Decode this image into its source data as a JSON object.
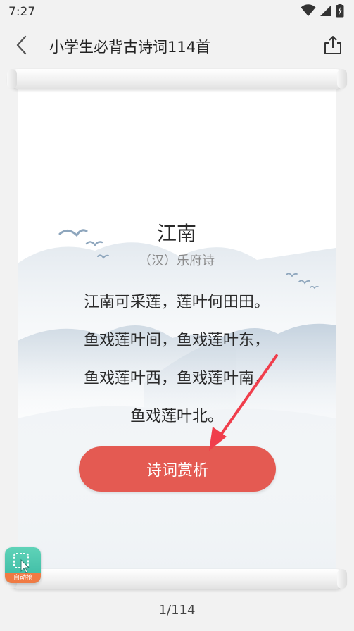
{
  "status_bar": {
    "time": "7:27",
    "icons": [
      "wifi-icon",
      "signal-icon",
      "battery-charging-icon"
    ]
  },
  "header": {
    "title": "小学生必背古诗词114首",
    "back_icon": "chevron-left-icon",
    "share_icon": "share-icon"
  },
  "poem": {
    "title": "江南",
    "author": "（汉）乐府诗",
    "lines": [
      "江南可采莲，莲叶何田田。",
      "鱼戏莲叶间，鱼戏莲叶东，",
      "鱼戏莲叶西，鱼戏莲叶南，",
      "鱼戏莲叶北。"
    ]
  },
  "actions": {
    "appreciate_label": "诗词赏析"
  },
  "floating_widget": {
    "label": "自动抢"
  },
  "pager": {
    "text": "1/114"
  },
  "colors": {
    "accent": "#e45a52",
    "annotation_arrow": "#f03e4c",
    "background": "#f2f2f2"
  }
}
